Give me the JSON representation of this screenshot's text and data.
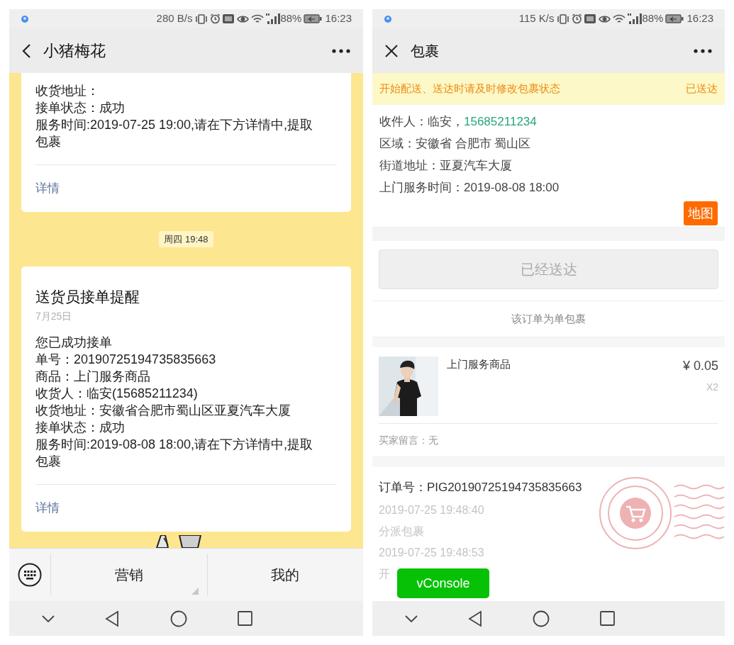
{
  "chat_screen": {
    "status_bar": {
      "speed": "280 B/s",
      "battery": "88%",
      "time": "16:23"
    },
    "header": {
      "title": "小猪梅花"
    },
    "messages": [
      {
        "kind": "card",
        "lines": [
          "收货地址：",
          "接单状态：成功",
          "服务时间:2019-07-25 19:00,请在下方详情中,提取包裹"
        ],
        "link": "详情"
      },
      {
        "kind": "time",
        "text": "周四 19:48"
      },
      {
        "kind": "card",
        "title": "送货员接单提醒",
        "date": "7月25日",
        "lines": [
          "您已成功接单",
          "单号：20190725194735835663",
          "商品：上门服务商品",
          "收货人：临安(15685211234)",
          "收货地址：安徽省合肥市蜀山区亚夏汽车大厦",
          "接单状态：成功",
          "服务时间:2019-08-08 18:00,请在下方详情中,提取包裹"
        ],
        "link": "详情"
      }
    ],
    "menu": [
      {
        "label": "营销",
        "has_submenu": true
      },
      {
        "label": "我的",
        "has_submenu": false
      }
    ]
  },
  "parcel_screen": {
    "status_bar": {
      "speed": "115 K/s",
      "battery": "88%",
      "time": "16:23"
    },
    "header": {
      "title": "包裹"
    },
    "banner": {
      "message": "开始配送、送达时请及时修改包裹状态",
      "status": "已送达"
    },
    "recipient": {
      "label": "收件人：临安，",
      "phone": "15685211234"
    },
    "info_lines": [
      "区域：安徽省 合肥市 蜀山区",
      "街道地址：亚夏汽车大厦",
      "上门服务时间：2019-08-08 18:00"
    ],
    "map_button": "地图",
    "action_button": {
      "label": "已经送达",
      "disabled": true
    },
    "parcel_note": "该订单为单包裹",
    "item": {
      "name": "上门服务商品",
      "price": "¥ 0.05",
      "quantity": "X2"
    },
    "buyer_note": "买家留言：无",
    "order_number": "订单号：PIG20190725194735835663",
    "timeline": [
      {
        "time": "2019-07-25 19:48:40",
        "event": "分派包裹"
      },
      {
        "time": "2019-07-25 19:48:53",
        "event": "开"
      }
    ],
    "console_button": "vConsole"
  }
}
